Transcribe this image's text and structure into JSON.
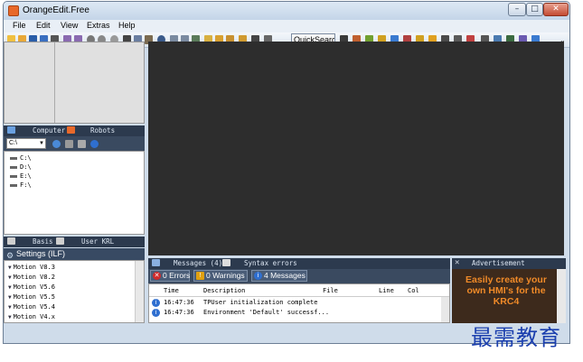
{
  "window": {
    "title": "OrangeEdit.Free",
    "controls": {
      "minimize": "–",
      "maximize": "□",
      "close": "✕"
    }
  },
  "menu": [
    "File",
    "Edit",
    "View",
    "Extras",
    "Help"
  ],
  "toolbar": {
    "quicksearch": "QuickSearch",
    "expand": "⌄"
  },
  "explorer": {
    "tabs": [
      "Computer",
      "Robots"
    ],
    "drive_select": "C:\\",
    "drives": [
      "C:\\",
      "D:\\",
      "E:\\",
      "F:\\"
    ]
  },
  "settings": {
    "tabs": [
      "Basis",
      "User KRL"
    ],
    "header": "Settings (ILF)",
    "items": [
      "Motion V8.3",
      "Motion V8.2",
      "Motion V5.6",
      "Motion V5.5",
      "Motion V5.4",
      "Motion V4.x"
    ]
  },
  "messages": {
    "tabs": [
      "Messages (4)",
      "Syntax errors"
    ],
    "filters": {
      "errors": "0 Errors",
      "warnings": "0 Warnings",
      "messages": "4 Messages"
    },
    "columns": [
      "Time",
      "Description",
      "File",
      "Line",
      "Col"
    ],
    "rows": [
      {
        "time": "16:47:36",
        "description": "TPUser initialization complete"
      },
      {
        "time": "16:47:36",
        "description": "Environment 'Default' successf..."
      }
    ]
  },
  "advertisement": {
    "tab": "Advertisement",
    "text": "Easily create your own HMI's for the KRC4"
  },
  "watermark": "最需教育",
  "colors": {
    "accent": "#e8692a",
    "editor_bg": "#2d2d2d",
    "panel_header": "#2c3a4e",
    "ad_text": "#f08a28"
  }
}
